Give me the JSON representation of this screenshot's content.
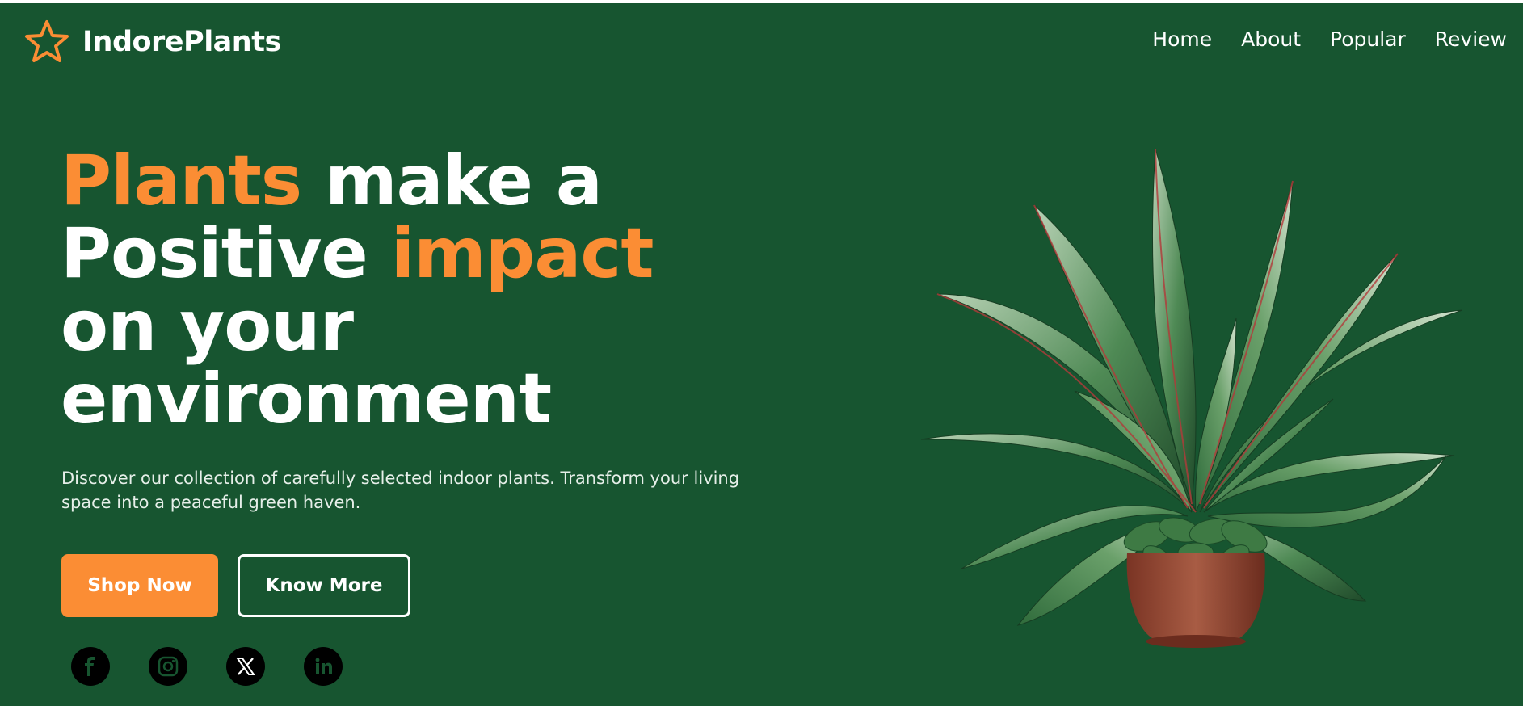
{
  "brand": {
    "name": "IndorePlants",
    "logo_icon": "star-outline-icon",
    "accent": "#fb8d34"
  },
  "nav": {
    "items": [
      "Home",
      "About",
      "Popular",
      "Review"
    ]
  },
  "hero": {
    "line1_accent": "Plants",
    "line1_rest": " make a",
    "line2_start": "Positive ",
    "line2_accent": "impact",
    "line3": "on your",
    "line4": "environment",
    "description": "Discover our collection of carefully selected indoor plants. Transform your living space into a peaceful green haven.",
    "primary_button": "Shop Now",
    "secondary_button": "Know More"
  },
  "social": {
    "icons": [
      "facebook-icon",
      "instagram-icon",
      "x-icon",
      "linkedin-icon"
    ]
  },
  "colors": {
    "background": "#175530",
    "accent": "#fb8d34",
    "text": "#ffffff"
  }
}
